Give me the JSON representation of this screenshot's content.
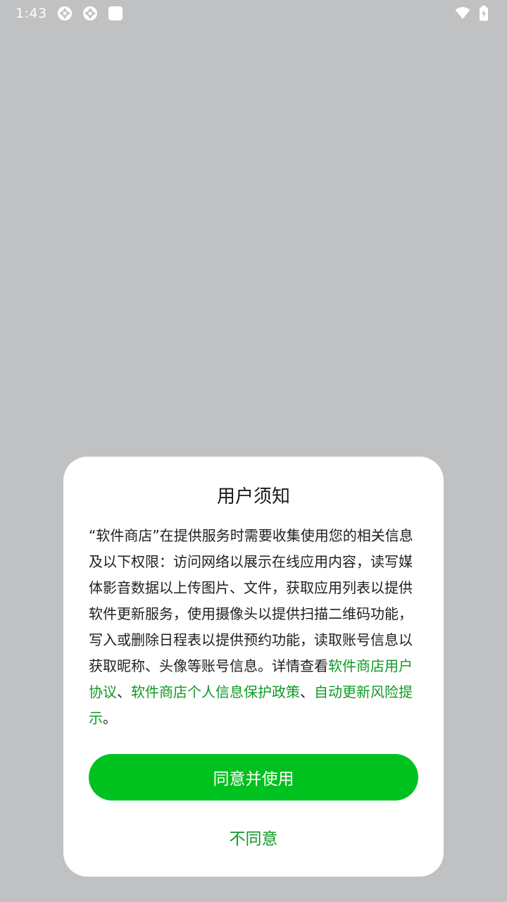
{
  "status_bar": {
    "time": "1:43",
    "left_icons": [
      "aperture-icon",
      "aperture-icon",
      "app-square-icon"
    ],
    "right_icons": [
      "wifi-icon",
      "battery-charging-icon"
    ]
  },
  "dialog": {
    "title": "用户须知",
    "body_intro": "“软件商店”在提供服务时需要收集使用您的相关信息及以下权限：访问网络以展示在线应用内容，读写媒体影音数据以上传图片、文件，获取应用列表以提供软件更新服务，使用摄像头以提供扫描二维码功能，写入或删除日程表以提供预约功能，读取账号信息以获取昵称、头像等账号信息。详情查看",
    "link_user_agreement": "软件商店用户协议",
    "sep1": "、",
    "link_privacy_policy": "软件商店个人信息保护政策",
    "sep2": "、",
    "link_auto_update_risk": "自动更新风险提示",
    "end_punct": "。",
    "agree_button": "同意并使用",
    "disagree_button": "不同意"
  },
  "colors": {
    "background": "#c0c1c3",
    "dialog_bg": "#ffffff",
    "accent_green": "#00c21e",
    "link_green": "#0f9a25"
  }
}
